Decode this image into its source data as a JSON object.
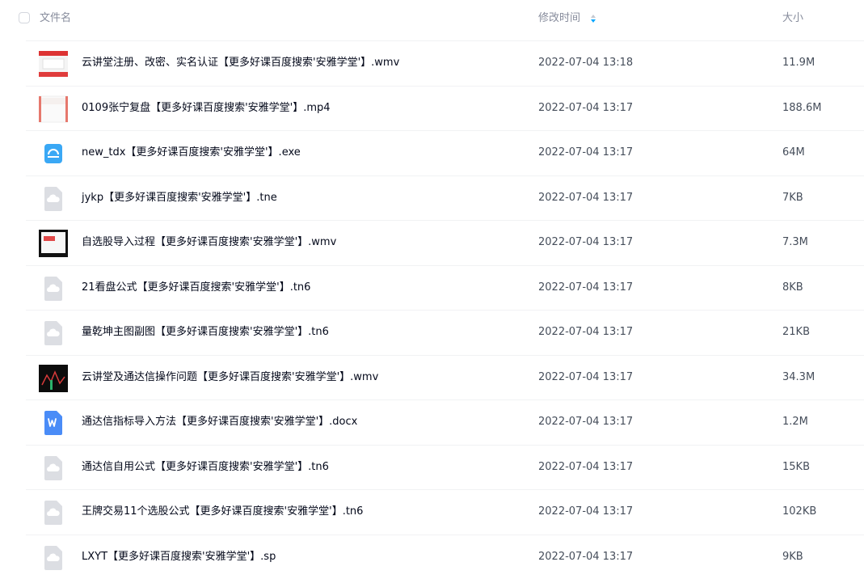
{
  "header": {
    "name_label": "文件名",
    "time_label": "修改时间",
    "size_label": "大小"
  },
  "files": [
    {
      "name": "云讲堂注册、改密、实名认证【更多好课百度搜索'安雅学堂'】.wmv",
      "time": "2022-07-04 13:18",
      "size": "11.9M",
      "icon": "video-thumbnail-icon"
    },
    {
      "name": "0109张宁复盘【更多好课百度搜索'安雅学堂'】.mp4",
      "time": "2022-07-04 13:17",
      "size": "188.6M",
      "icon": "video-thumbnail-icon"
    },
    {
      "name": "new_tdx【更多好课百度搜索'安雅学堂'】.exe",
      "time": "2022-07-04 13:17",
      "size": "64M",
      "icon": "exe-file-icon"
    },
    {
      "name": "jykp【更多好课百度搜索'安雅学堂'】.tne",
      "time": "2022-07-04 13:17",
      "size": "7KB",
      "icon": "cloud-file-icon"
    },
    {
      "name": "自选股导入过程【更多好课百度搜索'安雅学堂'】.wmv",
      "time": "2022-07-04 13:17",
      "size": "7.3M",
      "icon": "video-thumbnail-icon"
    },
    {
      "name": "21看盘公式【更多好课百度搜索'安雅学堂'】.tn6",
      "time": "2022-07-04 13:17",
      "size": "8KB",
      "icon": "cloud-file-icon"
    },
    {
      "name": "量乾坤主图副图【更多好课百度搜索'安雅学堂'】.tn6",
      "time": "2022-07-04 13:17",
      "size": "21KB",
      "icon": "cloud-file-icon"
    },
    {
      "name": "云讲堂及通达信操作问题【更多好课百度搜索'安雅学堂'】.wmv",
      "time": "2022-07-04 13:17",
      "size": "34.3M",
      "icon": "video-thumbnail-icon"
    },
    {
      "name": "通达信指标导入方法【更多好课百度搜索'安雅学堂'】.docx",
      "time": "2022-07-04 13:17",
      "size": "1.2M",
      "icon": "word-file-icon"
    },
    {
      "name": "通达信自用公式【更多好课百度搜索'安雅学堂'】.tn6",
      "time": "2022-07-04 13:17",
      "size": "15KB",
      "icon": "cloud-file-icon"
    },
    {
      "name": "王牌交易11个选股公式【更多好课百度搜索'安雅学堂'】.tn6",
      "time": "2022-07-04 13:17",
      "size": "102KB",
      "icon": "cloud-file-icon"
    },
    {
      "name": "LXYT【更多好课百度搜索'安雅学堂'】.sp",
      "time": "2022-07-04 13:17",
      "size": "9KB",
      "icon": "cloud-file-icon"
    }
  ],
  "colors": {
    "accent": "#06a7ff",
    "word": "#4a8cf7",
    "exe": "#3aa8f5",
    "generic": "#d9dbe0"
  }
}
